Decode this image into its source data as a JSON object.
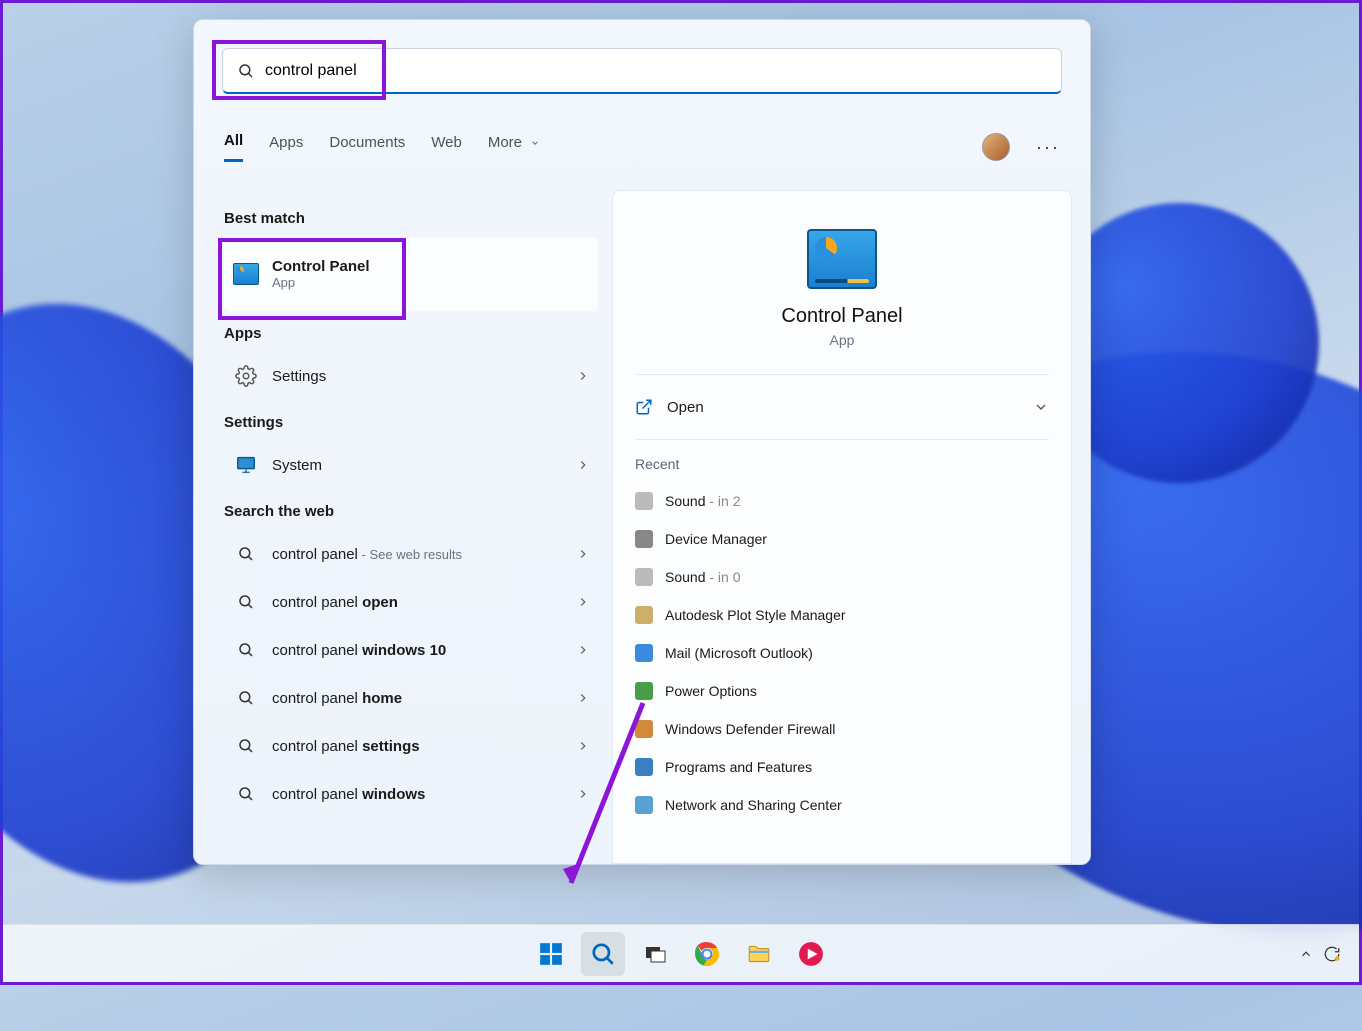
{
  "search": {
    "query": "control panel"
  },
  "tabs": {
    "all": "All",
    "apps": "Apps",
    "documents": "Documents",
    "web": "Web",
    "more": "More"
  },
  "sections": {
    "best_match": "Best match",
    "apps": "Apps",
    "settings": "Settings",
    "web": "Search the web"
  },
  "best_match": {
    "title": "Control Panel",
    "subtitle": "App"
  },
  "apps_list": [
    {
      "label": "Settings"
    }
  ],
  "settings_list": [
    {
      "label": "System"
    }
  ],
  "web_list": [
    {
      "prefix": "control panel",
      "bold": "",
      "suffix": " - See web results"
    },
    {
      "prefix": "control panel ",
      "bold": "open",
      "suffix": ""
    },
    {
      "prefix": "control panel ",
      "bold": "windows 10",
      "suffix": ""
    },
    {
      "prefix": "control panel ",
      "bold": "home",
      "suffix": ""
    },
    {
      "prefix": "control panel ",
      "bold": "settings",
      "suffix": ""
    },
    {
      "prefix": "control panel ",
      "bold": "windows",
      "suffix": ""
    }
  ],
  "preview": {
    "title": "Control Panel",
    "subtitle": "App",
    "open_label": "Open",
    "recent_heading": "Recent",
    "recent": [
      {
        "label": "Sound",
        "meta": " - in 2"
      },
      {
        "label": "Device Manager",
        "meta": ""
      },
      {
        "label": "Sound",
        "meta": " - in 0"
      },
      {
        "label": "Autodesk Plot Style Manager",
        "meta": ""
      },
      {
        "label": "Mail (Microsoft Outlook)",
        "meta": ""
      },
      {
        "label": "Power Options",
        "meta": ""
      },
      {
        "label": "Windows Defender Firewall",
        "meta": ""
      },
      {
        "label": "Programs and Features",
        "meta": ""
      },
      {
        "label": "Network and Sharing Center",
        "meta": ""
      }
    ]
  }
}
